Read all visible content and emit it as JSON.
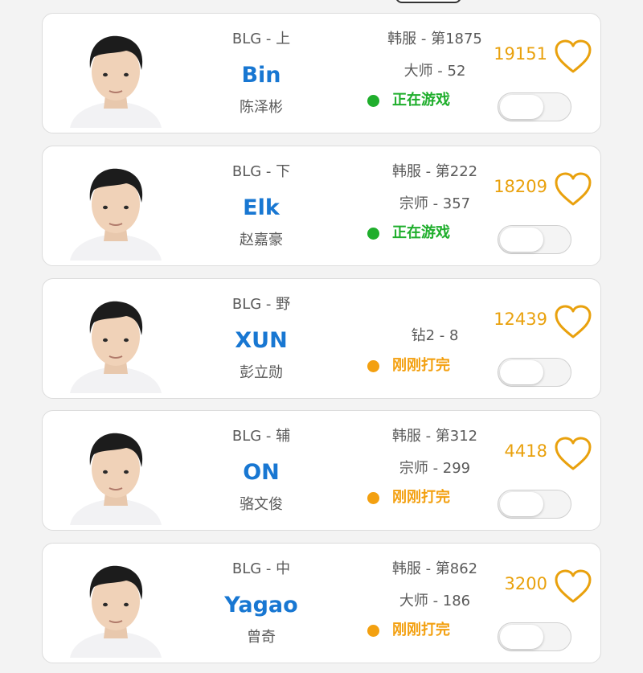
{
  "colors": {
    "accent_blue": "#1877d2",
    "likes_orange": "#e9a10d",
    "playing_green": "#1fae2c",
    "just_finished_orange": "#f3a010"
  },
  "players": [
    {
      "team_pos": "BLG - 上",
      "id": "Bin",
      "real_name": "陈泽彬",
      "server_rank": "韩服 - 第1875",
      "tier": "大师 - 52",
      "status": "正在游戏",
      "status_kind": "playing",
      "likes": "19151",
      "toggle_on": false
    },
    {
      "team_pos": "BLG - 下",
      "id": "Elk",
      "real_name": "赵嘉豪",
      "server_rank": "韩服 - 第222",
      "tier": "宗师 - 357",
      "status": "正在游戏",
      "status_kind": "playing",
      "likes": "18209",
      "toggle_on": false
    },
    {
      "team_pos": "BLG - 野",
      "id": "XUN",
      "real_name": "彭立勋",
      "server_rank": "",
      "tier": "钻2 - 8",
      "status": "刚刚打完",
      "status_kind": "just_finished",
      "likes": "12439",
      "toggle_on": false
    },
    {
      "team_pos": "BLG - 辅",
      "id": "ON",
      "real_name": "骆文俊",
      "server_rank": "韩服 - 第312",
      "tier": "宗师 - 299",
      "status": "刚刚打完",
      "status_kind": "just_finished",
      "likes": "4418",
      "toggle_on": false
    },
    {
      "team_pos": "BLG - 中",
      "id": "Yagao",
      "real_name": "曾奇",
      "server_rank": "韩服 - 第862",
      "tier": "大师 - 186",
      "status": "刚刚打完",
      "status_kind": "just_finished",
      "likes": "3200",
      "toggle_on": false
    }
  ]
}
